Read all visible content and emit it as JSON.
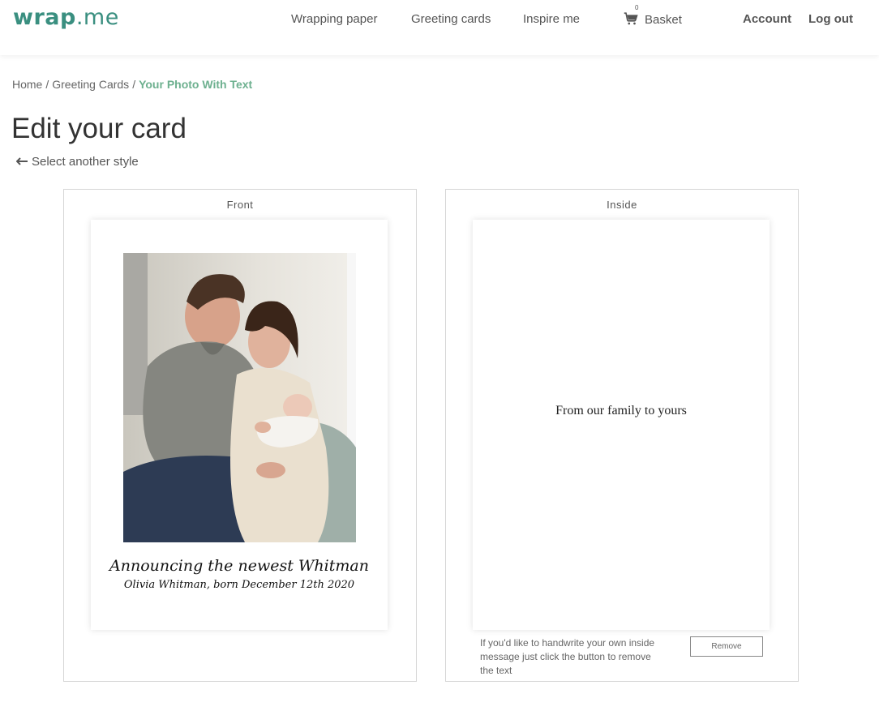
{
  "header": {
    "logo": {
      "part1": "wrap",
      "dot": ".",
      "part2": "me"
    },
    "nav": {
      "wrapping_paper": "Wrapping paper",
      "greeting_cards": "Greeting cards",
      "inspire_me": "Inspire me",
      "basket": "Basket",
      "basket_count": "0",
      "account": "Account",
      "log_out": "Log out"
    }
  },
  "breadcrumb": {
    "home": "Home",
    "separator": "/",
    "greeting_cards": "Greeting Cards",
    "current": "Your Photo With Text"
  },
  "page": {
    "title": "Edit your card",
    "back_link": "Select another style"
  },
  "front_panel": {
    "title": "Front",
    "caption_main": "Announcing the newest Whitman",
    "caption_sub": "Olivia Whitman, born December 12th 2020"
  },
  "inside_panel": {
    "title": "Inside",
    "message": "From our family to yours",
    "note": "If you'd like to handwrite your own inside message just click the button to remove the text",
    "remove_button": "Remove"
  },
  "colors": {
    "brand": "#3a8f80",
    "breadcrumb_current": "#6db08f"
  },
  "icons": {
    "cart": "shopping-cart-icon",
    "back": "arrow-left-icon"
  }
}
